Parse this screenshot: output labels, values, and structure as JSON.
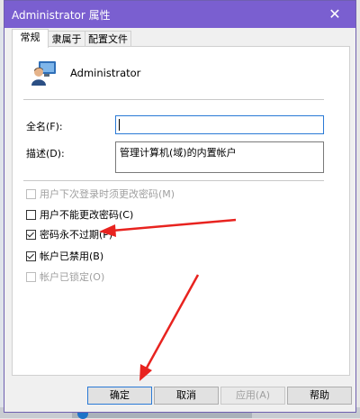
{
  "window": {
    "title": "Administrator 属性",
    "close_glyph": "✕"
  },
  "tabs": [
    {
      "label": "常规",
      "active": true
    },
    {
      "label": "隶属于",
      "active": false
    },
    {
      "label": "配置文件",
      "active": false
    }
  ],
  "user": {
    "icon": "user-account-icon",
    "name": "Administrator"
  },
  "fields": {
    "full_name_label": "全名(F):",
    "full_name_value": "",
    "description_label": "描述(D):",
    "description_value": "管理计算机(域)的内置帐户"
  },
  "options": [
    {
      "label": "用户下次登录时须更改密码(M)",
      "checked": false,
      "enabled": false
    },
    {
      "label": "用户不能更改密码(C)",
      "checked": false,
      "enabled": true
    },
    {
      "label": "密码永不过期(P)",
      "checked": true,
      "enabled": true
    },
    {
      "label": "帐户已禁用(B)",
      "checked": true,
      "enabled": true
    },
    {
      "label": "帐户已锁定(O)",
      "checked": false,
      "enabled": false
    }
  ],
  "buttons": {
    "ok": "确定",
    "cancel": "取消",
    "apply": "应用(A)",
    "help": "帮助"
  },
  "colors": {
    "titlebar": "#7a5fd0",
    "annotation_arrow": "#e8231f"
  }
}
